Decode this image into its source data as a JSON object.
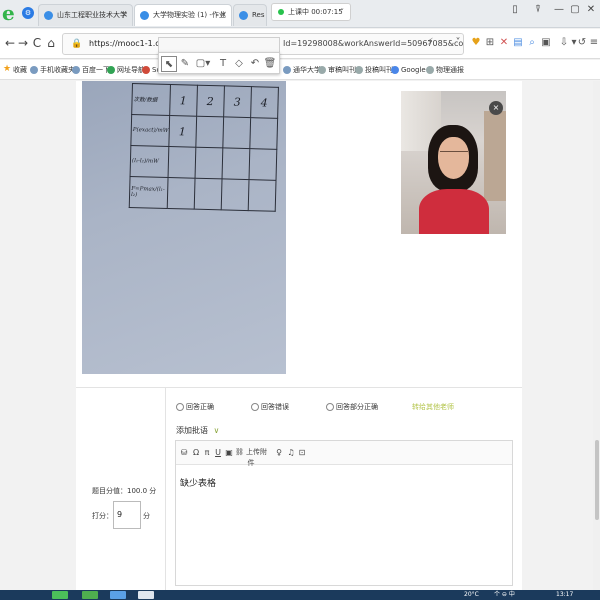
{
  "browser": {
    "tabs": [
      {
        "label": "山东工程职业技术大学"
      },
      {
        "label": "大学物理实验 (1) -作业"
      },
      {
        "label": "Res"
      }
    ],
    "timer": {
      "text": "上课中 00:07:15",
      "caret": "˅"
    },
    "window_controls": [
      "▯",
      "⍒",
      "—",
      "▢",
      "✕"
    ],
    "nav": {
      "back": "←",
      "forward": "→",
      "reload": "C",
      "home": "⌂"
    },
    "url": {
      "start": "https://mooc1-1.chaoxi",
      "end": "Id=19298008&workAnswerId=50967085&cou"
    },
    "addr_icons": [
      "⚡",
      "˅",
      "♥",
      "⊞",
      "✕",
      "▤",
      "⌕",
      "▣",
      "⇩",
      "▾",
      "↺",
      "≡"
    ]
  },
  "annotation_toolbar": {
    "tools": [
      "⬉",
      "✎",
      "▢▾",
      "T",
      "◇",
      "↶",
      "🗑"
    ]
  },
  "bookmarks": [
    {
      "label": "收藏",
      "icon": "star-icon"
    },
    {
      "label": "手机收藏夹",
      "icon": "phone-icon"
    },
    {
      "label": "百度一下",
      "icon": "baidu-icon"
    },
    {
      "label": "网址导航",
      "icon": "nav-icon"
    },
    {
      "label": "Sci",
      "icon": "sci-icon"
    },
    {
      "label": "通华大学",
      "icon": "school-icon"
    },
    {
      "label": "审稿叫刊",
      "icon": "review-icon"
    },
    {
      "label": "投稿叫刊",
      "icon": "submit-icon"
    },
    {
      "label": "Google",
      "icon": "google-icon"
    },
    {
      "label": "物理通报",
      "icon": "globe-icon"
    }
  ],
  "photo_table": {
    "header": [
      "次数/数据",
      "1",
      "2",
      "3",
      "4"
    ],
    "rows": [
      {
        "label": "P(exact)/mW",
        "cells": [
          "1",
          "",
          "",
          ""
        ]
      },
      {
        "label": "(l₁-l₂)/mW",
        "cells": [
          "",
          "",
          "",
          ""
        ]
      },
      {
        "label": "F=Pmax/(l₁-l₂)",
        "cells": [
          "",
          "",
          "",
          ""
        ]
      },
      {
        "label": "",
        "cells": [
          "",
          "",
          "",
          ""
        ]
      }
    ]
  },
  "video": {
    "close": "×"
  },
  "grading": {
    "options": [
      "回答正确",
      "回答错误",
      "回答部分正确"
    ],
    "transfer": "转给其他老师",
    "add_comment": "添加批语",
    "add_comment_chev": "∨",
    "toolbar": [
      "⛁",
      "Ω",
      "π",
      "U",
      "▣",
      "⛓ 上传附件",
      "♀",
      "♫",
      "⊡"
    ],
    "comment_text": "缺少表格",
    "score_label": "题目分值：100.0 分",
    "grade_label": "打分：",
    "grade_value": "9",
    "grade_unit": "分"
  },
  "taskbar": {
    "weather": "20°C",
    "tray": "个 ⊖ 中",
    "time": "13:17"
  }
}
